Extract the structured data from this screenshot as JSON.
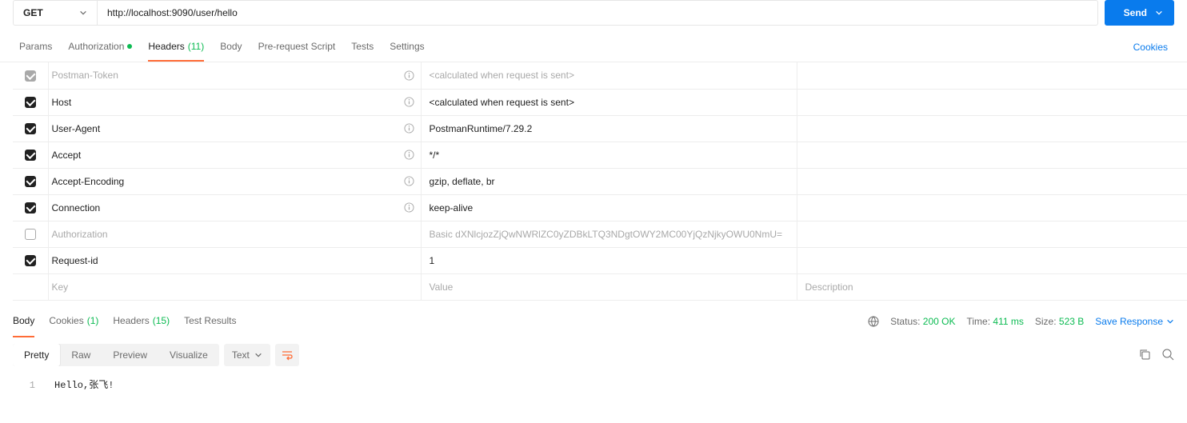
{
  "request": {
    "method": "GET",
    "url": "http://localhost:9090/user/hello",
    "send_label": "Send"
  },
  "req_tabs": {
    "params": "Params",
    "auth": "Authorization",
    "headers": "Headers",
    "headers_count": "(11)",
    "body": "Body",
    "prerequest": "Pre-request Script",
    "tests": "Tests",
    "settings": "Settings",
    "cookies": "Cookies"
  },
  "headers": [
    {
      "checked": "grey",
      "key": "Postman-Token",
      "value": "<calculated when request is sent>",
      "info": true,
      "dim": true
    },
    {
      "checked": true,
      "key": "Host",
      "value": "<calculated when request is sent>",
      "info": true
    },
    {
      "checked": true,
      "key": "User-Agent",
      "value": "PostmanRuntime/7.29.2",
      "info": true
    },
    {
      "checked": true,
      "key": "Accept",
      "value": "*/*",
      "info": true
    },
    {
      "checked": true,
      "key": "Accept-Encoding",
      "value": "gzip, deflate, br",
      "info": true
    },
    {
      "checked": true,
      "key": "Connection",
      "value": "keep-alive",
      "info": true
    },
    {
      "checked": false,
      "key": "Authorization",
      "value": "Basic dXNlcjozZjQwNWRlZC0yZDBkLTQ3NDgtOWY2MC00YjQzNjkyOWU0NmU=",
      "info": false,
      "dim": true
    },
    {
      "checked": true,
      "key": "Request-id",
      "value": "1",
      "info": false
    }
  ],
  "placeholder": {
    "key": "Key",
    "value": "Value",
    "desc": "Description"
  },
  "resp_tabs": {
    "body": "Body",
    "cookies": "Cookies",
    "cookies_count": "(1)",
    "headers": "Headers",
    "headers_count": "(15)",
    "test_results": "Test Results"
  },
  "status": {
    "status_label": "Status:",
    "status_value": "200 OK",
    "time_label": "Time:",
    "time_value": "411 ms",
    "size_label": "Size:",
    "size_value": "523 B",
    "save": "Save Response"
  },
  "view": {
    "pretty": "Pretty",
    "raw": "Raw",
    "preview": "Preview",
    "visualize": "Visualize",
    "format": "Text"
  },
  "response_body": {
    "line1_no": "1",
    "line1_text": "Hello,张飞!"
  }
}
